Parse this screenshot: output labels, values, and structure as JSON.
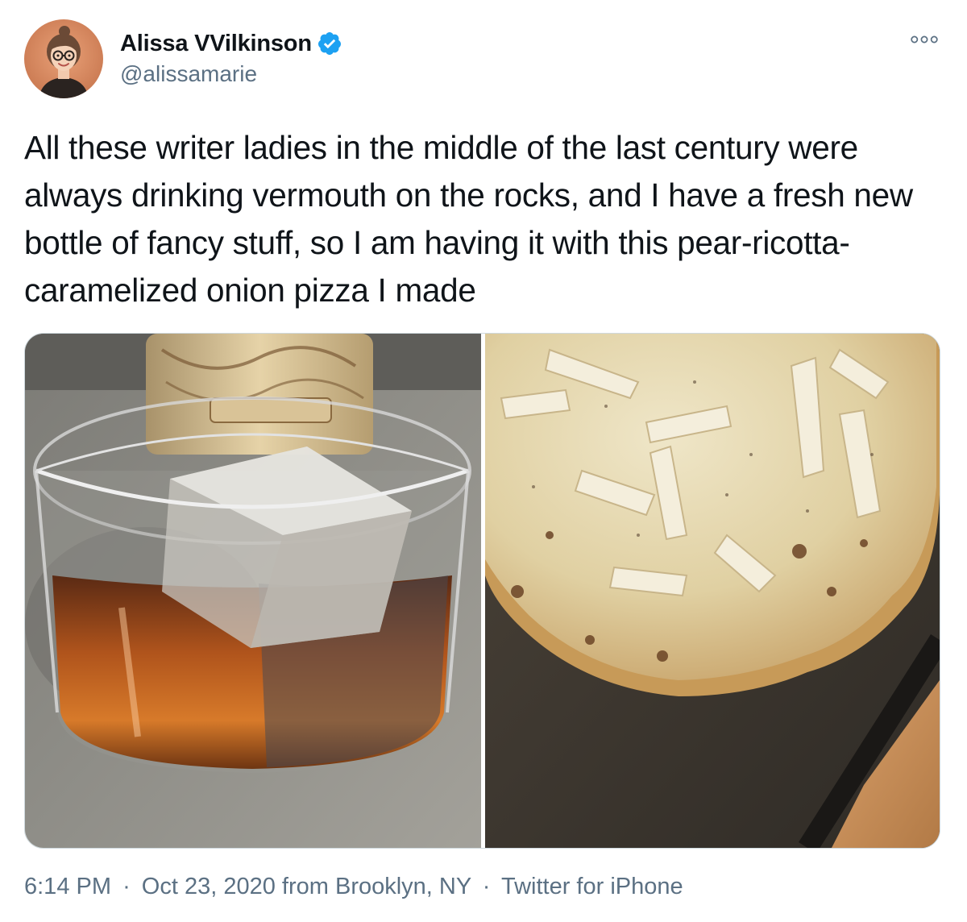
{
  "author": {
    "display_name": "Alissa VVilkinson",
    "handle": "@alissamarie",
    "verified": true,
    "avatar_icon": "cartoon-avatar"
  },
  "more_icon": "more-dots-icon",
  "tweet": {
    "text": "All these writer ladies in the middle of the last century were always drinking vermouth on the rocks, and I have a fresh new bottle of fancy stuff, so I am having it with this pear-ricotta-caramelized onion pizza I made"
  },
  "media": {
    "photos": [
      {
        "name": "vermouth-glass-photo"
      },
      {
        "name": "pizza-photo"
      }
    ]
  },
  "footer": {
    "time": "6:14 PM",
    "separator": "·",
    "date": "Oct 23, 2020",
    "location": "from Brooklyn, NY",
    "source": "Twitter for iPhone"
  },
  "colors": {
    "text": "#0f1419",
    "secondary": "#5b7083",
    "verified_blue": "#1da1f2",
    "border": "#cfd9de"
  }
}
